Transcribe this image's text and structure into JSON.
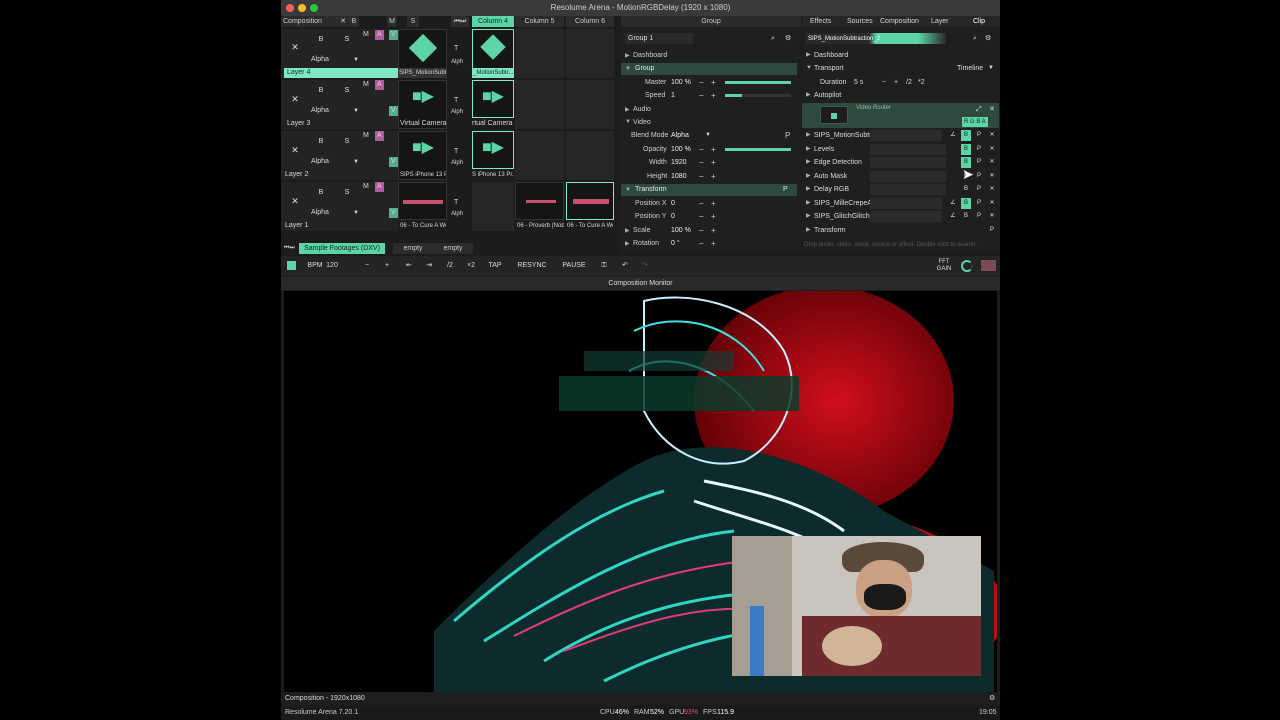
{
  "window": {
    "title": "Resolume Arena - MotionRGBDelay (1920 x 1080)"
  },
  "composition": {
    "label": "Composition",
    "x_button": "✕",
    "b_button": "B",
    "s_button": "S",
    "columns": [
      "Column 4",
      "Column 5",
      "Column 6"
    ],
    "layers": [
      {
        "name": "Layer 4",
        "blend": "Alpha",
        "clips": [
          "SIPS_MotionSubt...",
          "_MotionSubtr..."
        ]
      },
      {
        "name": "Layer 3",
        "blend": "Alpha",
        "clips": [
          "Virtual Camera",
          "rtual Camera"
        ]
      },
      {
        "name": "Layer 2",
        "blend": "Alpha",
        "clips": [
          "SIPS iPhone 13 Pro...",
          "S iPhone 13 Pr..."
        ]
      },
      {
        "name": "Layer 1",
        "blend": "Alpha",
        "clips": [
          "06 - To Cure A Wea...",
          "06 - Proverb (Nob...",
          "06 - To Cure A We..."
        ]
      }
    ],
    "layer_b": "B",
    "layer_s": "S",
    "layer_m": "M",
    "layer_a": "A",
    "layer_v": "V",
    "small_t": "T",
    "small_alph": "Alph",
    "decks": [
      "Sample Footages (DXV)",
      "empty",
      "empty"
    ]
  },
  "group_panel": {
    "title": "Group",
    "search_value": "Group 1",
    "dashboard": "Dashboard",
    "group_section": "Group",
    "master_label": "Master",
    "master_value": "100 %",
    "master_fraction": 1.0,
    "speed_label": "Speed",
    "speed_value": "1",
    "speed_fraction": 0.25,
    "audio": "Audio",
    "video": "Video",
    "blend_label": "Blend Mode",
    "blend_value": "Alpha",
    "opacity_label": "Opacity",
    "opacity_value": "100 %",
    "opacity_fraction": 1.0,
    "width_label": "Width",
    "width_value": "1920",
    "height_label": "Height",
    "height_value": "1080",
    "transform": "Transform",
    "posx_label": "Position X",
    "posx_value": "0",
    "posy_label": "Position Y",
    "posy_value": "0",
    "scale_label": "Scale",
    "scale_value": "100 %",
    "rotation_label": "Rotation",
    "rotation_value": "0 °",
    "p_button": "P"
  },
  "right_panel": {
    "tabs": [
      "Effects",
      "Sources",
      "Composition",
      "Layer",
      "Clip"
    ],
    "clip_name": "SIPS_MotionSubtraction_2",
    "dashboard": "Dashboard",
    "transport": "Transport",
    "timeline": "Timeline",
    "duration_label": "Duration",
    "duration_value": "5 s",
    "div2": "/2",
    "mul2": "*2",
    "autopilot": "Autopilot",
    "video_router": "Video Router",
    "rgba": "R G B A",
    "effects": [
      "SIPS_MotionSubtr",
      "Levels",
      "Edge Detection",
      "Auto Mask",
      "Delay RGB",
      "SIPS_MilleCrepeA",
      "SIPS_GlitchGlitchF"
    ],
    "transform": "Transform",
    "drop_hint": "Drop audio, video, mask, source or effect. Double click to search."
  },
  "toolbar": {
    "bpm_label": "BPM",
    "bpm_value": "120",
    "minus": "−",
    "plus": "+",
    "half": "/2",
    "double": "×2",
    "tap": "TAP",
    "resync": "RESYNC",
    "pause": "PAUSE",
    "fft_gain": "FFT GAIN"
  },
  "monitor": {
    "title": "Composition Monitor",
    "footer": "Composition - 1920x1080"
  },
  "status": {
    "version": "Resolume Arena 7.20.1",
    "cpu_label": "CPU",
    "cpu_value": "46%",
    "ram_label": "RAM",
    "ram_value": "52%",
    "gpu_label": "GPU",
    "gpu_value": "93%",
    "fps_label": "FPS",
    "fps_value": "115.9",
    "time": "19:05"
  }
}
